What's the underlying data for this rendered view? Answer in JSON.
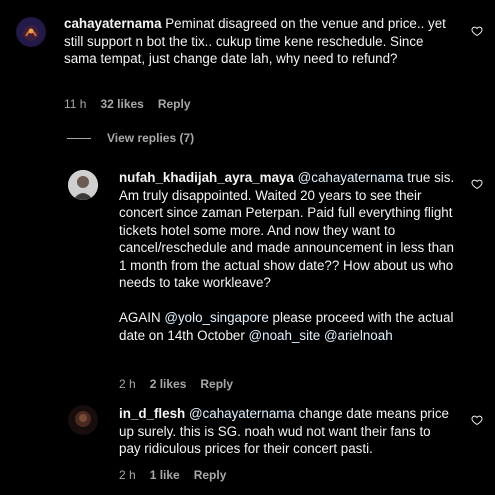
{
  "comments": [
    {
      "username": "cahayaternama",
      "text": "Peminat disagreed on the venue and price.. yet still support n bot the tix.. cukup time kene reschedule. Since sama tempat, just change date lah, why need to refund?",
      "time": "11 h",
      "likes": "32 likes",
      "reply": "Reply"
    },
    {
      "username": "nufah_khadijah_ayra_maya",
      "mention1": "@cahayaternama",
      "text1": " true sis. Am truly disappointed. Waited 20 years to see their concert since zaman Peterpan. Paid full everything flight tickets hotel some more. And now they want to cancel/reschedule and made announcement in less than 1 month from the actual show date?? How about us who needs to take workleave?",
      "text2a": "AGAIN ",
      "mention2": "@yolo_singapore",
      "text2b": " please proceed with the actual date on 14th October ",
      "mention3": "@noah_site",
      "mention4": "@arielnoah",
      "time": "2 h",
      "likes": "2 likes",
      "reply": "Reply"
    },
    {
      "username": "in_d_flesh",
      "mention1": "@cahayaternama",
      "text1": " change date means price up surely. this is SG. noah wud not want their fans to pay ridiculous prices for their concert pasti.",
      "time": "2 h",
      "likes": "1 like",
      "reply": "Reply"
    }
  ],
  "view_replies": "View replies (7)",
  "colors": {
    "background": "#000000",
    "text": "#f5f5f5",
    "meta": "#a8a8a8",
    "mention": "#e0f1ff"
  },
  "icons": {
    "like": "heart-outline-icon"
  }
}
